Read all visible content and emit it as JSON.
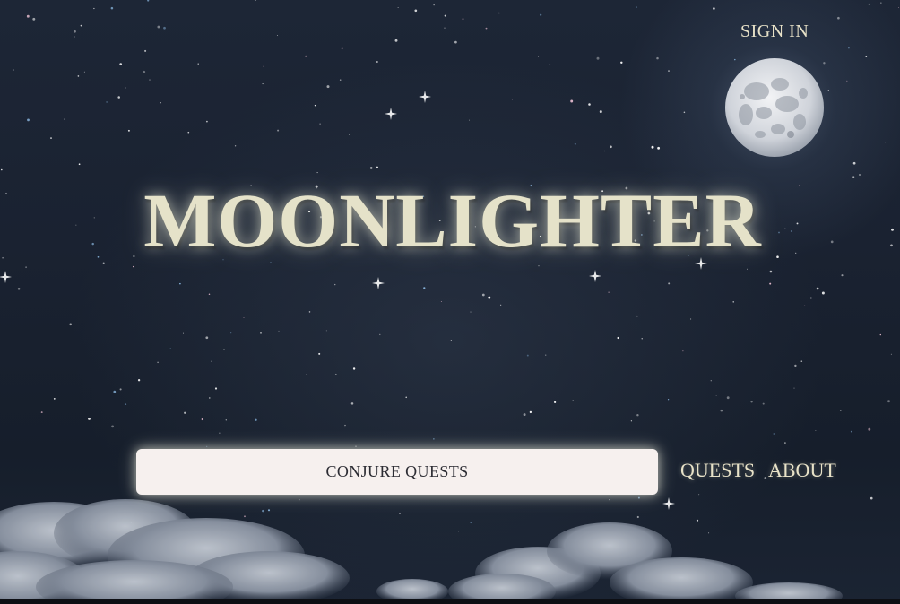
{
  "header": {
    "sign_in_label": "SIGN IN"
  },
  "hero": {
    "title": "MOONLIGHTER"
  },
  "search": {
    "button_label": "CONJURE QUESTS"
  },
  "nav": {
    "quests_label": "QUESTS",
    "about_label": "ABOUT"
  },
  "icons": {
    "moon": "moon-icon"
  },
  "colors": {
    "sky": "#1a2231",
    "title_text": "#e5e2c9",
    "search_bg": "#f6f0ee",
    "link_text": "#e8e2c8"
  }
}
